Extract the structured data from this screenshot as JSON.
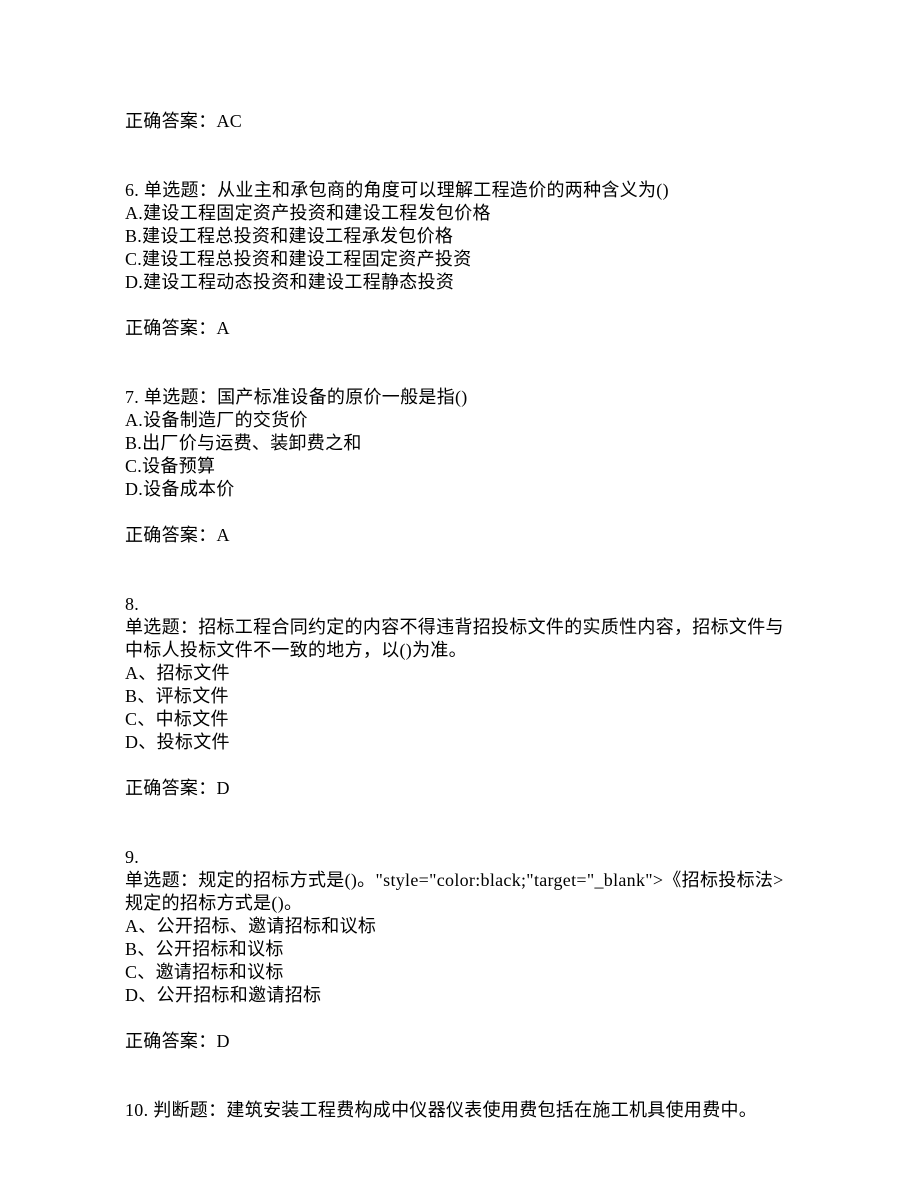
{
  "answer_prev": "正确答案：AC",
  "q6": {
    "stem": "6. 单选题：从业主和承包商的角度可以理解工程造价的两种含义为()",
    "a": "A.建设工程固定资产投资和建设工程发包价格",
    "b": "B.建设工程总投资和建设工程承发包价格",
    "c": "C.建设工程总投资和建设工程固定资产投资",
    "d": "D.建设工程动态投资和建设工程静态投资",
    "answer": "正确答案：A"
  },
  "q7": {
    "stem": "7. 单选题：国产标准设备的原价一般是指()",
    "a": "A.设备制造厂的交货价",
    "b": "B.出厂价与运费、装卸费之和",
    "c": "C.设备预算",
    "d": "D.设备成本价",
    "answer": "正确答案：A"
  },
  "q8": {
    "num": "8.",
    "stem": "单选题：招标工程合同约定的内容不得违背招投标文件的实质性内容，招标文件与中标人投标文件不一致的地方，以()为准。",
    "a": "A、招标文件",
    "b": "B、评标文件",
    "c": "C、中标文件",
    "d": "D、投标文件",
    "answer": "正确答案：D"
  },
  "q9": {
    "num": "9.",
    "stem": "单选题：规定的招标方式是()。\"style=\"color:black;\"target=\"_blank\">《招标投标法>规定的招标方式是()。",
    "a": "A、公开招标、邀请招标和议标",
    "b": "B、公开招标和议标",
    "c": "C、邀请招标和议标",
    "d": "D、公开招标和邀请招标",
    "answer": "正确答案：D"
  },
  "q10": {
    "stem": "10. 判断题：建筑安装工程费构成中仪器仪表使用费包括在施工机具使用费中。"
  }
}
